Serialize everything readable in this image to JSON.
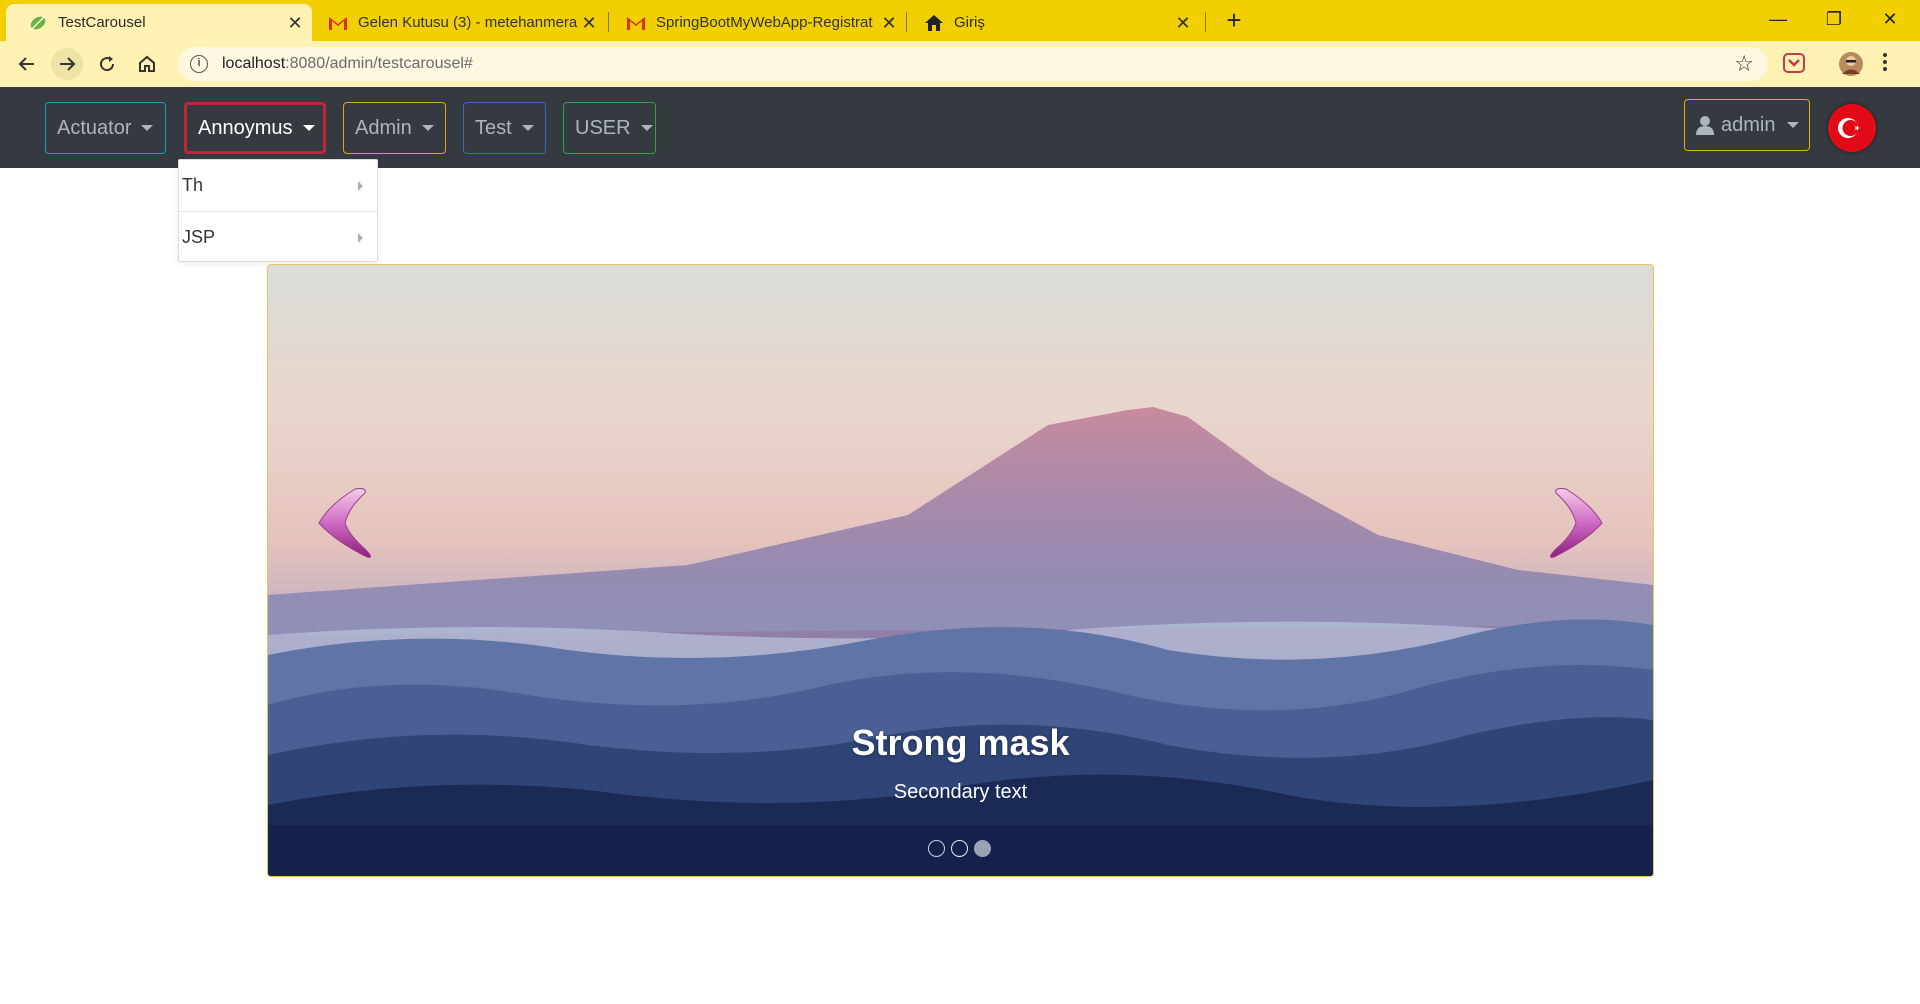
{
  "browser": {
    "tabs": [
      {
        "title": "TestCarousel",
        "icon": "spring-leaf-icon",
        "active": true
      },
      {
        "title": "Gelen Kutusu (3) - metehanmeral",
        "icon": "gmail-icon",
        "active": false
      },
      {
        "title": "SpringBootMyWebApp-Registrat",
        "icon": "gmail-icon",
        "active": false
      },
      {
        "title": "Giriş",
        "icon": "home-icon",
        "active": false
      }
    ],
    "url_host": "localhost",
    "url_path": ":8080/admin/testcarousel#"
  },
  "navbar": {
    "menus": [
      {
        "label": "Actuator",
        "border_color": "#17a2b8"
      },
      {
        "label": "Annoymus",
        "border_color": "#c0253a",
        "active": true
      },
      {
        "label": "Admin",
        "border_color": "#d8a520"
      },
      {
        "label": "Test",
        "border_color": "#3568c8"
      },
      {
        "label": "USER",
        "border_color": "#28a745"
      }
    ],
    "user_label": "admin",
    "language": "turkey-flag-icon"
  },
  "dropdown": {
    "items": [
      {
        "label": "Th"
      },
      {
        "label": "JSP"
      }
    ]
  },
  "carousel": {
    "caption_title": "Strong mask",
    "caption_text": "Secondary text",
    "slide_count": 3,
    "active_slide": 3,
    "accent_color": "#c35bc0"
  }
}
